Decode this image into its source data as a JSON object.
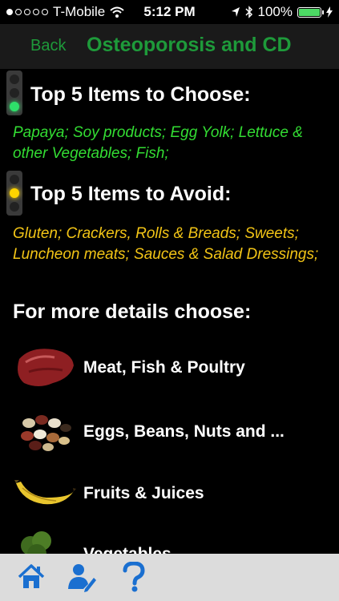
{
  "status": {
    "carrier": "T-Mobile",
    "time": "5:12 PM",
    "battery": "100%",
    "battery_level": 1.0
  },
  "nav": {
    "back_label": "Back",
    "title": "Osteoporosis and CD"
  },
  "choose": {
    "heading": "Top 5 Items to Choose:",
    "items": "Papaya; Soy products; Egg Yolk; Lettuce & other Vegetables; Fish;"
  },
  "avoid": {
    "heading": "Top 5 Items to Avoid:",
    "items": "Gluten; Crackers, Rolls & Breads; Sweets; Luncheon meats; Sauces & Salad Dressings;"
  },
  "details": {
    "heading": "For more details choose:",
    "categories": [
      {
        "label": "Meat, Fish & Poultry",
        "icon": "meat-icon"
      },
      {
        "label": "Eggs, Beans, Nuts and ...",
        "icon": "beans-icon"
      },
      {
        "label": "Fruits & Juices",
        "icon": "banana-icon"
      },
      {
        "label": "Vegetables",
        "icon": "broccoli-icon"
      }
    ]
  },
  "tabs": [
    {
      "name": "home",
      "icon": "home-icon"
    },
    {
      "name": "profile",
      "icon": "user-edit-icon"
    },
    {
      "name": "help",
      "icon": "question-icon"
    }
  ],
  "colors": {
    "nav_title": "#1e9a3a",
    "choose_text": "#33dd33",
    "avoid_text": "#f2c416",
    "tab_icon": "#1a6fd0",
    "battery": "#4cd964"
  }
}
